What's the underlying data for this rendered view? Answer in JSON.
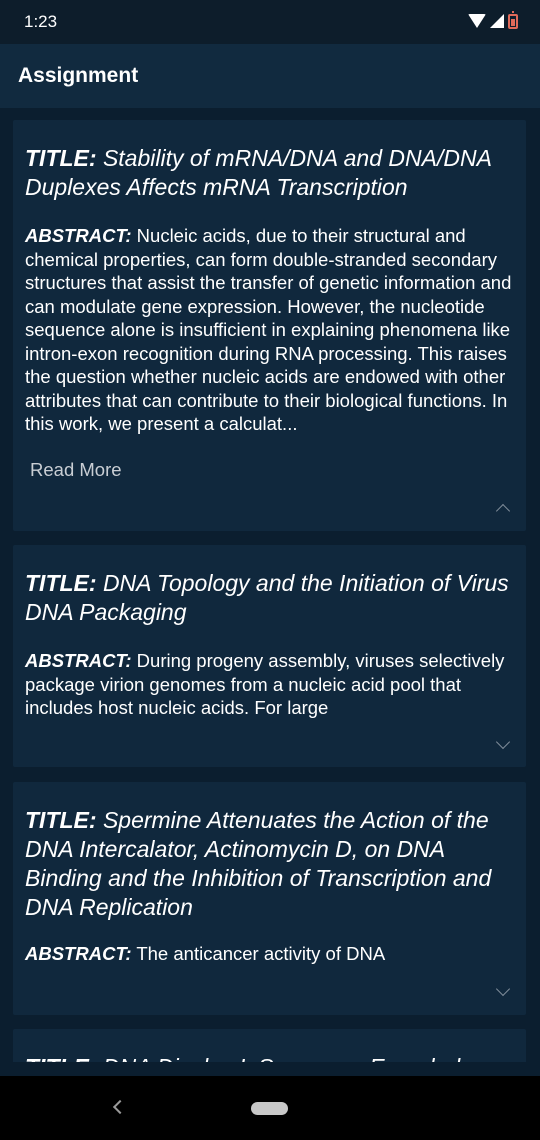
{
  "status_bar": {
    "time": "1:23"
  },
  "app_bar": {
    "title": "Assignment"
  },
  "cards": [
    {
      "title_label": "TITLE:",
      "title": "Stability of mRNA/DNA and DNA/DNA Duplexes Affects mRNA Transcription",
      "abstract_label": "ABSTRACT:",
      "abstract": "Nucleic acids, due to their structural and chemical properties, can form double-stranded secondary structures that assist the transfer of genetic information and can modulate gene expression. However, the nucleotide sequence alone is insufficient in explaining phenomena like intron-exon recognition during RNA processing. This raises the question whether nucleic acids are endowed with other attributes that can contribute to their biological functions. In this work, we present a calculat...",
      "read_more": "Read More",
      "expanded": true
    },
    {
      "title_label": "TITLE:",
      "title": "DNA Topology and the Initiation of Virus DNA Packaging",
      "abstract_label": "ABSTRACT:",
      "abstract": "During progeny assembly, viruses selectively package virion genomes from a nucleic acid pool that includes host nucleic acids. For large",
      "expanded": false
    },
    {
      "title_label": "TITLE:",
      "title": "Spermine Attenuates the Action of the DNA Intercalator, Actinomycin D, on DNA Binding and the Inhibition of Transcription and DNA Replication",
      "abstract_label": "ABSTRACT:",
      "abstract": "The anticancer activity of DNA",
      "expanded": false
    },
    {
      "title_label": "TITLE:",
      "title": "DNA Display I. Sequence-Encoded"
    }
  ]
}
